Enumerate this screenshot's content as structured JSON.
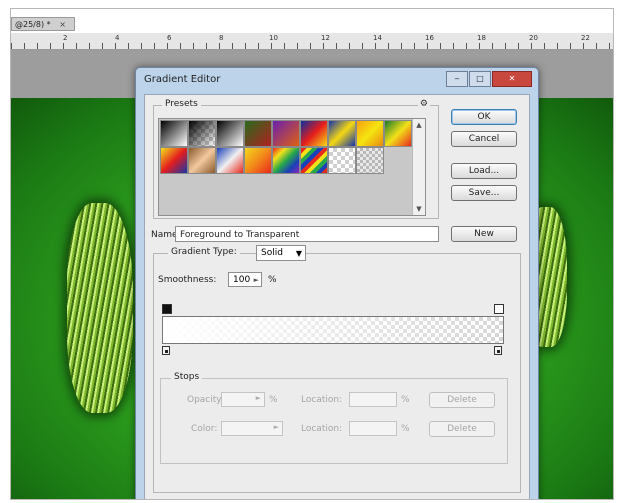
{
  "document": {
    "tab_title": "@25/8) *",
    "tab_close": "×"
  },
  "ruler": {
    "numbers": [
      "2",
      "4",
      "6",
      "8",
      "10",
      "12",
      "14",
      "16",
      "18",
      "20",
      "22"
    ]
  },
  "dialog": {
    "title": "Gradient Editor",
    "buttons": {
      "minimize": "‒",
      "maximize": "□",
      "close": "✕",
      "ok": "OK",
      "cancel": "Cancel",
      "load": "Load...",
      "save": "Save...",
      "new": "New"
    },
    "presets": {
      "label": "Presets",
      "menu_icon": "gear-icon",
      "swatches": [
        "linear-gradient(135deg,#000,#fff)",
        "linear-gradient(135deg,#000,rgba(0,0,0,0)),repeating-conic-gradient(#ccc 0 25%,#fff 0 50%) 0 0/8px 8px",
        "linear-gradient(135deg,#000,#fff)",
        "linear-gradient(135deg,#2a6b1c,#b02020)",
        "linear-gradient(135deg,#6a1fb0,#e06010)",
        "linear-gradient(135deg,#0b2f9e,#e41d1d,#f7dc14)",
        "linear-gradient(135deg,#1635a8,#f4d812,#1635a8)",
        "linear-gradient(135deg,#f8a010,#f5e410,#e88a10)",
        "linear-gradient(135deg,#1a7a2a,#f2e11a,#e8291c)",
        "linear-gradient(135deg,#f2e11a,#e41d1d,#1635a8)",
        "linear-gradient(135deg,#8a5a2a,#f2c8a0,#8a5a2a)",
        "linear-gradient(135deg,#1a3fb8,#f0f0f0,#e8291c)",
        "linear-gradient(135deg,#f2d81a,#f28a1a,#e8291c)",
        "linear-gradient(135deg,#e8291c,#f2e11a,#28a84a,#1a3fb8,#8a28b8)",
        "repeating-linear-gradient(135deg,#e8291c 0 4px,#f2e11a 4px 8px,#28a84a 8px 12px,#1a3fb8 12px 16px)",
        "repeating-conic-gradient(#d0d0d0 0 25%,#fff 0 50%) 0 0/8px 8px",
        "repeating-conic-gradient(#b8b8b8 0 25%,#e8e8e8 0 50%) 0 0/6px 6px"
      ]
    },
    "name": {
      "label": "Name:",
      "value": "Foreground to Transparent"
    },
    "gradient_type": {
      "label": "Gradient Type:",
      "value": "Solid"
    },
    "smoothness": {
      "label": "Smoothness:",
      "value": "100",
      "unit": "%"
    },
    "stops": {
      "label": "Stops",
      "opacity_label": "Opacity:",
      "opacity_unit": "%",
      "color_label": "Color:",
      "location_label": "Location:",
      "location_unit": "%",
      "delete_label": "Delete"
    }
  }
}
